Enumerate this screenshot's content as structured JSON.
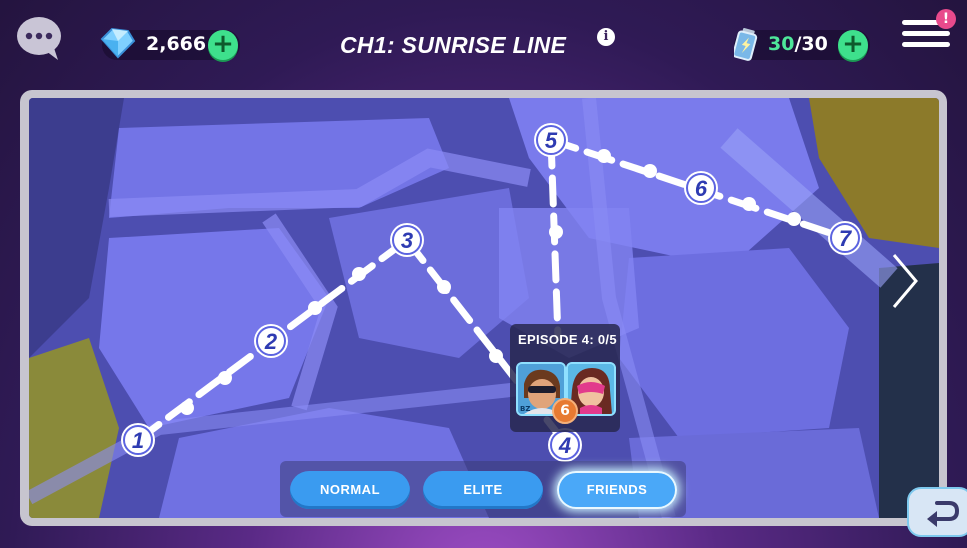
{
  "header": {
    "chapter_title": "CH1: SUNRISE LINE",
    "gems": "2,666",
    "energy_current": "30",
    "energy_sep": "/30",
    "plus": "+",
    "notification": "!",
    "info": "i"
  },
  "map": {
    "nodes": [
      "1",
      "2",
      "3",
      "4",
      "5",
      "6",
      "7"
    ]
  },
  "episode": {
    "label": "EPISODE 4: 0/5",
    "level_badge": "6",
    "hero_tag": "BZ"
  },
  "modes": {
    "normal": "NORMAL",
    "elite": "ELITE",
    "friends": "FRIENDS",
    "active": "FRIENDS"
  },
  "colors": {
    "accent_green": "#3ee08c",
    "map_blue": "#6f6ee0",
    "path_white": "#ffffff",
    "node_text": "#2e3bb2",
    "button_blue": "#3a9bf0"
  },
  "icons": {
    "chat": "chat-bubble-icon",
    "gem": "gem-icon",
    "energy": "battery-icon",
    "info": "info-icon",
    "menu": "hamburger-menu-icon",
    "next": "chevron-right-icon",
    "back": "return-arrow-icon"
  }
}
